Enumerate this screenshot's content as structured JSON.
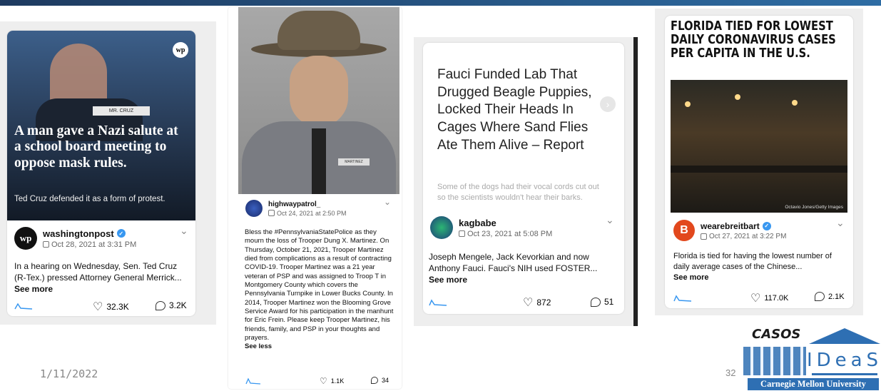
{
  "slide": {
    "date": "1/11/2022",
    "page_number": "32",
    "logo_text": "CASOS",
    "logo_ideas": "IDeaS",
    "university": "Carnegie Mellon University"
  },
  "posts": [
    {
      "image_logo": "wp",
      "image_headline": "A man gave a Nazi salute at a school board meeting to oppose mask rules.",
      "image_subtext": "Ted Cruz defended it as a form of protest.",
      "nameplate": "MR. CRUZ",
      "username": "washingtonpost",
      "verified": true,
      "date": "Oct 28, 2021 at 3:31 PM",
      "caption": "In a hearing on Wednesday, Sen. Ted Cruz (R-Tex.) pressed Attorney General Merrick...",
      "see_more": "See more",
      "likes": "32.3K",
      "comments": "3.2K",
      "avatar_text": "wp"
    },
    {
      "username": "highwaypatrol_",
      "verified": false,
      "date": "Oct 24, 2021 at 2:50 PM",
      "caption": "Bless the #PennsylvaniaStatePolice as they mourn the loss of Trooper Dung X. Martinez. On Thursday, October 21, 2021, Trooper Martinez died from complications as a result of contracting COVID-19. Trooper Martinez was a 21 year veteran of PSP and was assigned to Troop T in Montgomery County which covers the Pennsylvania Turnpike in Lower Bucks County. In 2014, Trooper Martinez won the Blooming Grove Service Award for his participation in the manhunt for Eric Frein. Please keep Trooper Martinez, his friends, family, and PSP in your thoughts and prayers.",
      "see_more": "See less",
      "likes": "1.1K",
      "comments": "34",
      "name_tag": "MARTINEZ"
    },
    {
      "image_headline": "Fauci Funded Lab That Drugged Beagle Puppies, Locked Their Heads In Cages Where Sand Flies Ate Them Alive – Report",
      "image_subtext": "Some of the dogs had their vocal cords cut out so the scientists wouldn't hear their barks.",
      "username": "kagbabe",
      "verified": false,
      "date": "Oct 23, 2021 at 5:08 PM",
      "caption": "Joseph Mengele, Jack Kevorkian and now Anthony Fauci. Fauci's NIH used FOSTER...",
      "see_more": "See more",
      "likes": "872",
      "comments": "51"
    },
    {
      "image_headline": "FLORIDA TIED FOR LOWEST DAILY CORONAVIRUS CASES PER CAPITA IN THE U.S.",
      "image_credit": "Octavio Jones/Getty Images",
      "username": "wearebreitbart",
      "verified": true,
      "date": "Oct 27, 2021 at 3:22 PM",
      "caption": "Florida is tied for having the lowest number of daily average cases of the Chinese...",
      "see_more": "See more",
      "likes": "117.0K",
      "comments": "2.1K",
      "avatar_text": "B"
    }
  ]
}
